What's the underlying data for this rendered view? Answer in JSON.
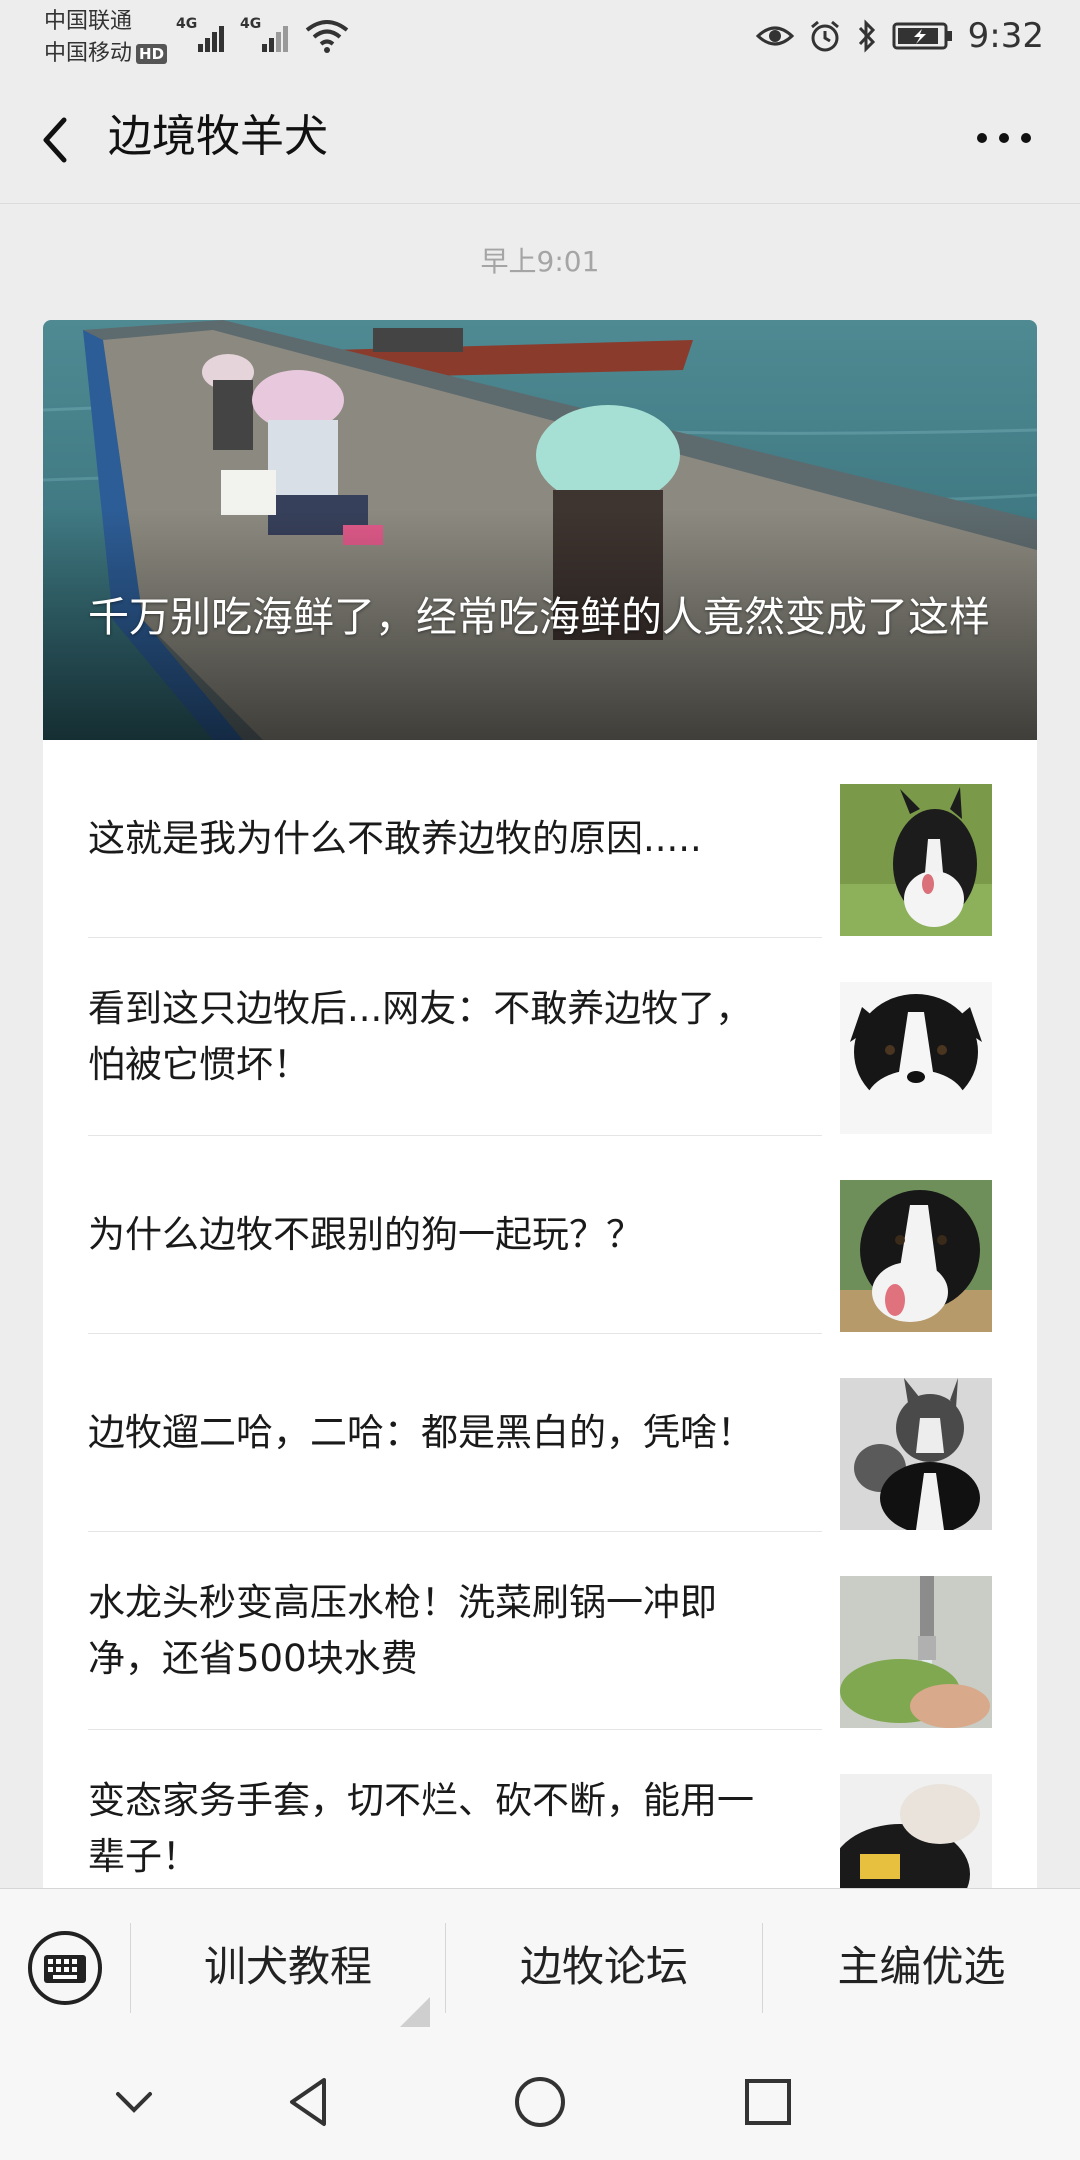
{
  "status_bar": {
    "carrier_1": "中国联通",
    "carrier_2": "中国移动",
    "hd_badge": "HD",
    "network_1": "4G",
    "network_2": "4G",
    "time": "9:32"
  },
  "nav": {
    "title": "边境牧羊犬"
  },
  "timestamp": "早上9:01",
  "hero": {
    "title": "千万别吃海鲜了，经常吃海鲜的人竟然变成了这样"
  },
  "articles": [
    {
      "title": "这就是我为什么不敢养边牧的原因.....",
      "thumb": "border-collie-thumbnail"
    },
    {
      "title": "看到这只边牧后...网友：不敢养边牧了，怕被它惯坏！",
      "thumb": "border-collie-face-thumbnail"
    },
    {
      "title": "为什么边牧不跟别的狗一起玩？？",
      "thumb": "border-collie-tongue-thumbnail"
    },
    {
      "title": "边牧遛二哈，二哈：都是黑白的，凭啥！",
      "thumb": "husky-and-collie-thumbnail"
    },
    {
      "title": "水龙头秒变高压水枪！洗菜刷锅一冲即净，还省500块水费",
      "thumb": "faucet-washing-vegetables-thumbnail"
    },
    {
      "title": "变态家务手套，切不烂、砍不断，能用一辈子！",
      "thumb": "glove-washing-pan-thumbnail"
    }
  ],
  "menu": {
    "items": [
      "训犬教程",
      "边牧论坛",
      "主编优选"
    ]
  },
  "colors": {
    "page_bg": "#ededed",
    "card_bg": "#ffffff",
    "timestamp": "#a5a5a5"
  }
}
